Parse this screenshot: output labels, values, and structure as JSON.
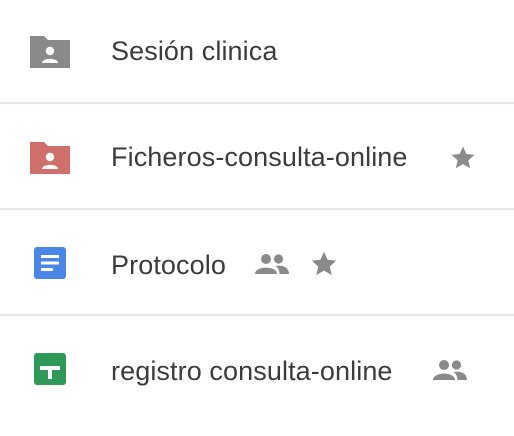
{
  "files": [
    {
      "name": "Sesión clinica",
      "type": "shared-folder",
      "icon": "shared-folder-icon",
      "icon_color": "#8a8a8a",
      "shared": false,
      "starred": false
    },
    {
      "name": "Ficheros-consulta-online",
      "type": "shared-folder",
      "icon": "shared-folder-icon",
      "icon_color": "#cf6f6a",
      "shared": false,
      "starred": true
    },
    {
      "name": "Protocolo",
      "type": "document",
      "icon": "docs-icon",
      "icon_color": "#4a86e8",
      "shared": true,
      "starred": true
    },
    {
      "name": "registro consulta-online",
      "type": "spreadsheet",
      "icon": "sheets-icon",
      "icon_color": "#2f9a57",
      "shared": true,
      "starred": false
    }
  ],
  "colors": {
    "text": "#3c3c3c",
    "badge": "#8a8a8a",
    "divider": "#e6e6ec",
    "background": "#ffffff"
  }
}
